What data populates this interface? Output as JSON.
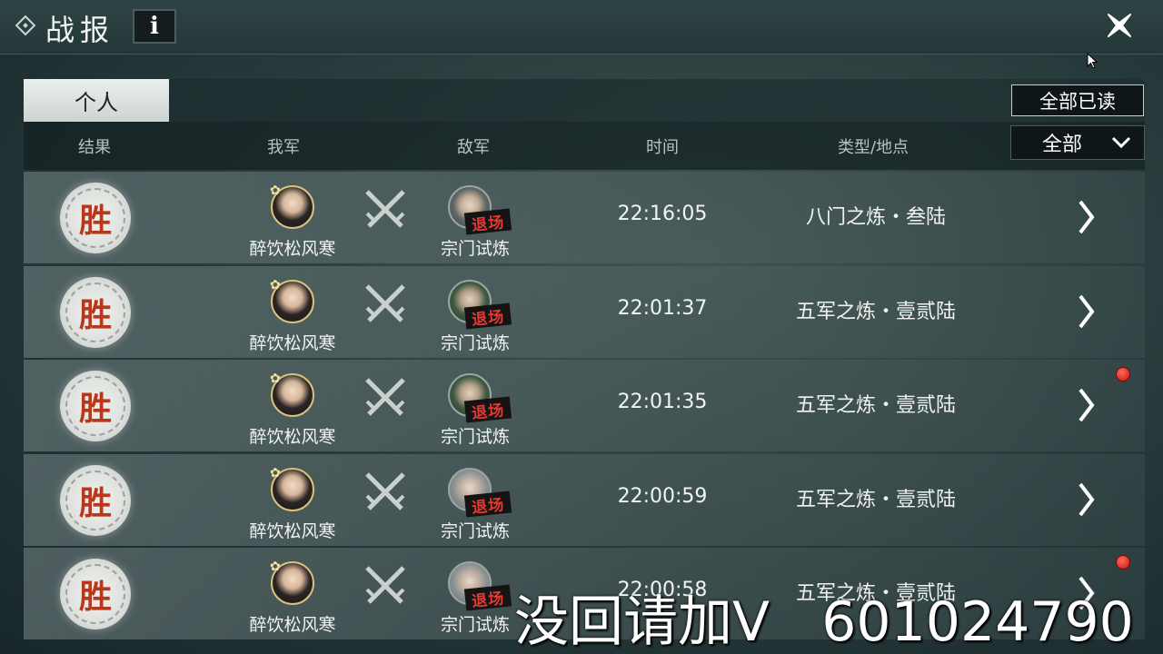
{
  "window": {
    "title": "战报",
    "info_label": "i"
  },
  "tabs": [
    {
      "label": "个人"
    }
  ],
  "mark_all_read": "全部已读",
  "filter": {
    "selected": "全部"
  },
  "columns": {
    "result": "结果",
    "ally": "我军",
    "enemy": "敌军",
    "time": "时间",
    "type_place": "类型/地点"
  },
  "rows": [
    {
      "result": "胜",
      "ally": "醉饮松风寒",
      "enemy": "宗门试炼",
      "enemy_status": "退场",
      "time": "22:16:05",
      "type_place": "八门之炼・叁陆",
      "unread": false
    },
    {
      "result": "胜",
      "ally": "醉饮松风寒",
      "enemy": "宗门试炼",
      "enemy_status": "退场",
      "time": "22:01:37",
      "type_place": "五军之炼・壹贰陆",
      "unread": false
    },
    {
      "result": "胜",
      "ally": "醉饮松风寒",
      "enemy": "宗门试炼",
      "enemy_status": "退场",
      "time": "22:01:35",
      "type_place": "五军之炼・壹贰陆",
      "unread": true
    },
    {
      "result": "胜",
      "ally": "醉饮松风寒",
      "enemy": "宗门试炼",
      "enemy_status": "退场",
      "time": "22:00:59",
      "type_place": "五军之炼・壹贰陆",
      "unread": false
    },
    {
      "result": "胜",
      "ally": "醉饮松风寒",
      "enemy": "宗门试炼",
      "enemy_status": "退场",
      "time": "22:00:58",
      "type_place": "五军之炼・壹贰陆",
      "unread": true
    }
  ],
  "overlay_text": "没回请加V   601024790",
  "colors": {
    "win_text": "#b7381d",
    "retreat_text": "#e23a33",
    "unread_dot": "#d0110b"
  },
  "icons": {
    "close": "close-x-icon",
    "dropdown": "chevron-down-icon",
    "versus": "crossed-swords-icon",
    "detail": "chevron-right-icon"
  }
}
